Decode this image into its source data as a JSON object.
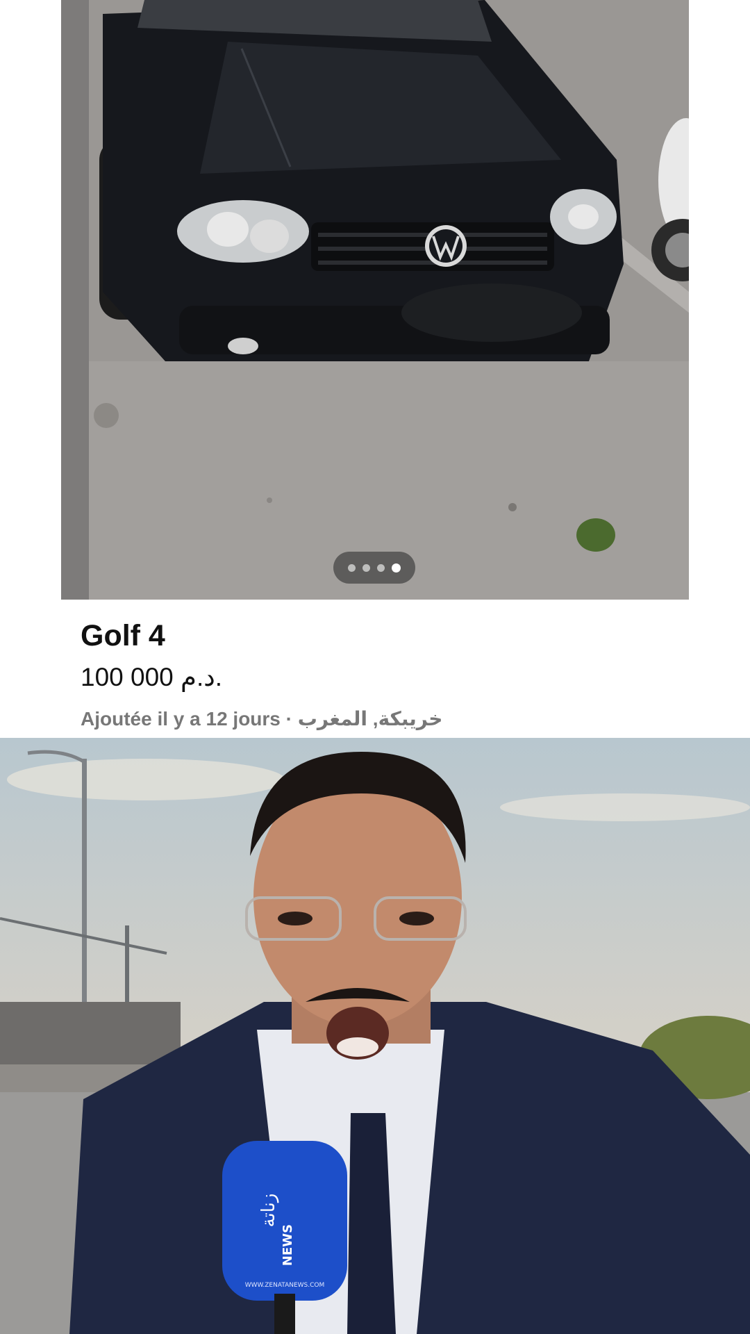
{
  "listing": {
    "title": "Golf 4",
    "price": "100 000 د.م.",
    "added": "Ajoutée il y a 12 jours",
    "separator": " · ",
    "location": "خريبكة, المغرب",
    "photo_count": 4,
    "active_photo": 4
  },
  "video": {
    "mic_brand": "زناتة",
    "mic_sub": "NEWS",
    "mic_url": "WWW.ZENATANEWS.COM"
  },
  "icons": {
    "car": "car-photo",
    "pager": "carousel-dots"
  }
}
